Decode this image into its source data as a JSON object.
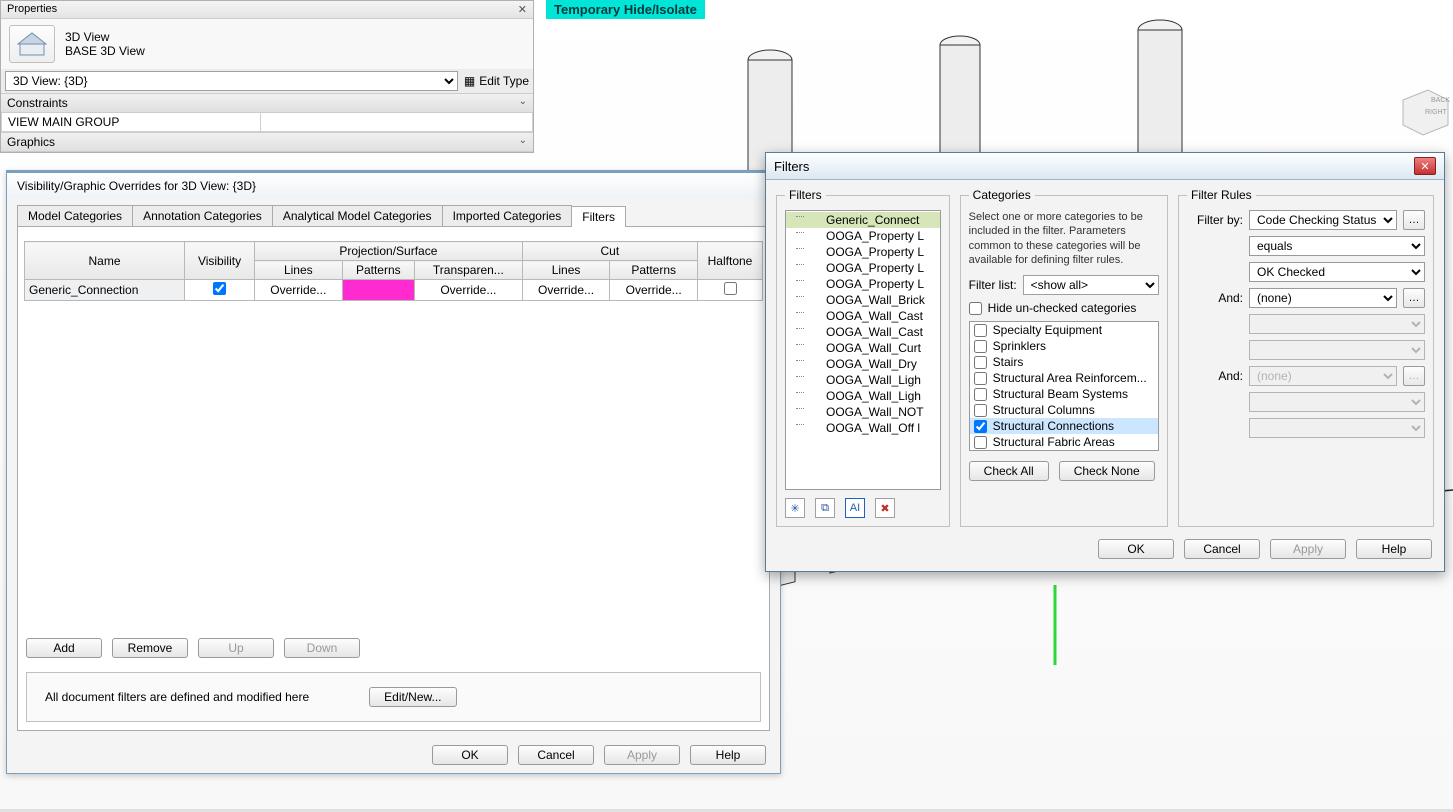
{
  "temp_hide_label": "Temporary Hide/Isolate",
  "properties": {
    "panel_title": "Properties",
    "view_type": "3D View",
    "view_name": "BASE 3D View",
    "selector": "3D View: {3D}",
    "edit_type": "Edit Type",
    "sections": {
      "constraints": "Constraints",
      "view_main_group": "VIEW MAIN GROUP",
      "graphics": "Graphics"
    }
  },
  "vg": {
    "title": "Visibility/Graphic Overrides for 3D View: {3D}",
    "tabs": [
      "Model Categories",
      "Annotation Categories",
      "Analytical Model Categories",
      "Imported Categories",
      "Filters"
    ],
    "active_tab": 4,
    "grid": {
      "h_name": "Name",
      "h_vis": "Visibility",
      "h_proj": "Projection/Surface",
      "h_cut": "Cut",
      "h_half": "Halftone",
      "h_lines": "Lines",
      "h_patterns": "Patterns",
      "h_transp": "Transparen...",
      "row_name": "Generic_Connection",
      "override": "Override..."
    },
    "buttons": {
      "add": "Add",
      "remove": "Remove",
      "up": "Up",
      "down": "Down",
      "editnew": "Edit/New..."
    },
    "note": "All document filters are defined and modified here",
    "footer": {
      "ok": "OK",
      "cancel": "Cancel",
      "apply": "Apply",
      "help": "Help"
    }
  },
  "filters": {
    "title": "Filters",
    "groups": {
      "filters": "Filters",
      "categories": "Categories",
      "rules": "Filter Rules"
    },
    "list": [
      "Generic_Connect",
      "OOGA_Property L",
      "OOGA_Property L",
      "OOGA_Property L",
      "OOGA_Property L",
      "OOGA_Wall_Brick",
      "OOGA_Wall_Cast",
      "OOGA_Wall_Cast",
      "OOGA_Wall_Curt",
      "OOGA_Wall_Dry",
      "OOGA_Wall_Ligh",
      "OOGA_Wall_Ligh",
      "OOGA_Wall_NOT",
      "OOGA_Wall_Off l"
    ],
    "desc": "Select one or more categories to be included in the filter.  Parameters common to these categories will be available for defining filter rules.",
    "filter_list_label": "Filter list:",
    "filter_list_value": "<show all>",
    "hide_unchecked": "Hide un-checked categories",
    "categories": [
      {
        "label": "Specialty Equipment",
        "checked": false
      },
      {
        "label": "Sprinklers",
        "checked": false
      },
      {
        "label": "Stairs",
        "checked": false
      },
      {
        "label": "Structural Area Reinforcem...",
        "checked": false
      },
      {
        "label": "Structural Beam Systems",
        "checked": false
      },
      {
        "label": "Structural Columns",
        "checked": false
      },
      {
        "label": "Structural Connections",
        "checked": true,
        "sel": true
      },
      {
        "label": "Structural Fabric Areas",
        "checked": false
      }
    ],
    "check_all": "Check All",
    "check_none": "Check None",
    "rules": {
      "filter_by": "Filter by:",
      "and": "And:",
      "param": "Code Checking Status",
      "op": "equals",
      "val": "OK Checked",
      "none": "(none)"
    },
    "footer": {
      "ok": "OK",
      "cancel": "Cancel",
      "apply": "Apply",
      "help": "Help"
    }
  },
  "viewcube": {
    "right": "RIGHT",
    "back": "BACK"
  }
}
